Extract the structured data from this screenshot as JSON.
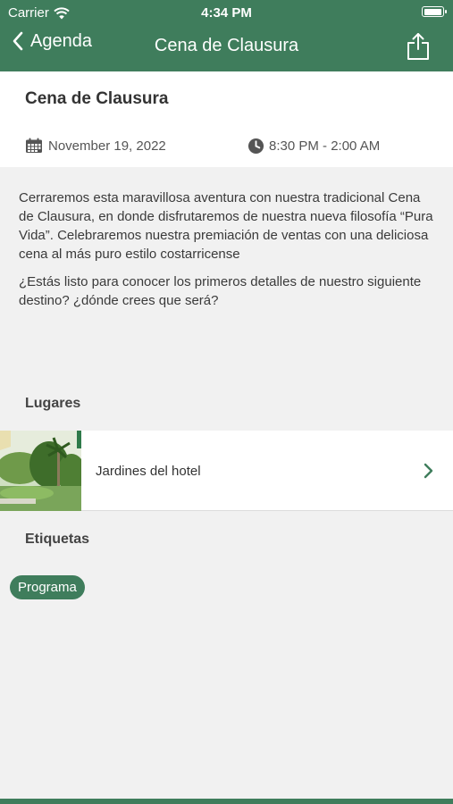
{
  "status_bar": {
    "carrier": "Carrier",
    "time": "4:34 PM",
    "battery_level": 0.95
  },
  "nav": {
    "back_label": "Agenda",
    "title": "Cena de Clausura"
  },
  "event": {
    "title": "Cena de Clausura",
    "date": "November 19, 2022",
    "time_range": "8:30 PM - 2:00 AM",
    "description": [
      "Cerraremos esta maravillosa aventura con nuestra tradicional Cena de Clausura, en donde disfrutaremos de nuestra nueva filosofía “Pura Vida”. Celebraremos nuestra premiación de ventas con una deliciosa cena al más puro estilo costarricense",
      "¿Estás listo para conocer los primeros detalles de nuestro siguiente destino? ¿dónde crees que será?"
    ]
  },
  "places": {
    "heading": "Lugares",
    "items": [
      {
        "name": "Jardines del hotel"
      }
    ]
  },
  "tags": {
    "heading": "Etiquetas",
    "items": [
      {
        "label": "Programa"
      }
    ]
  },
  "colors": {
    "accent": "#3f7d5c",
    "background": "#f1f1f1"
  },
  "icons": {
    "back": "chevron-left-icon",
    "share": "share-icon",
    "calendar": "calendar-icon",
    "clock": "clock-icon",
    "disclosure": "chevron-right-icon"
  }
}
